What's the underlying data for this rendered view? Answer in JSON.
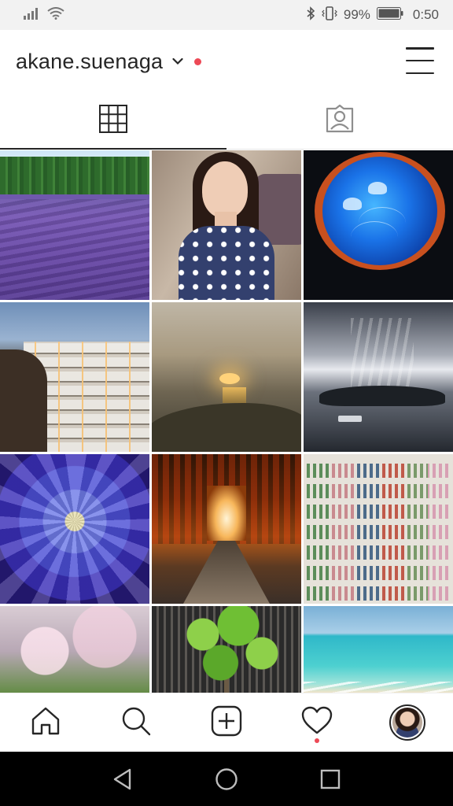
{
  "status_bar": {
    "battery_percent": "99%",
    "time": "0:50",
    "icons": [
      "signal-icon",
      "wifi-icon",
      "bluetooth-icon",
      "vibrate-icon",
      "battery-icon"
    ]
  },
  "header": {
    "username": "akane.suenaga",
    "icons": [
      "chevron-down-icon",
      "notification-dot",
      "menu-icon"
    ]
  },
  "tabs": [
    {
      "name": "grid",
      "icon": "grid-icon",
      "active": true
    },
    {
      "name": "tagged",
      "icon": "tagged-person-icon",
      "active": false
    }
  ],
  "grid": {
    "photos": [
      {
        "subject": "lavender-field"
      },
      {
        "subject": "portrait"
      },
      {
        "subject": "jellyfish-aquarium"
      },
      {
        "subject": "santorini-village"
      },
      {
        "subject": "sunset-sea"
      },
      {
        "subject": "clouds-island"
      },
      {
        "subject": "blue-flower"
      },
      {
        "subject": "torii-gates"
      },
      {
        "subject": "photo-wall"
      },
      {
        "subject": "cherry-tree"
      },
      {
        "subject": "maple-wall"
      },
      {
        "subject": "beach"
      }
    ]
  },
  "bottom_nav": {
    "items": [
      "home-icon",
      "search-icon",
      "add-post-icon",
      "activity-heart-icon",
      "profile-avatar"
    ],
    "activity_has_notification": true
  },
  "system_nav": {
    "items": [
      "back-icon",
      "home-circle-icon",
      "recents-icon"
    ]
  },
  "colors": {
    "accent_dot": "#ed4956",
    "text_primary": "#262626",
    "status_bar_bg": "#f2f2f2",
    "system_nav_bg": "#000000"
  }
}
